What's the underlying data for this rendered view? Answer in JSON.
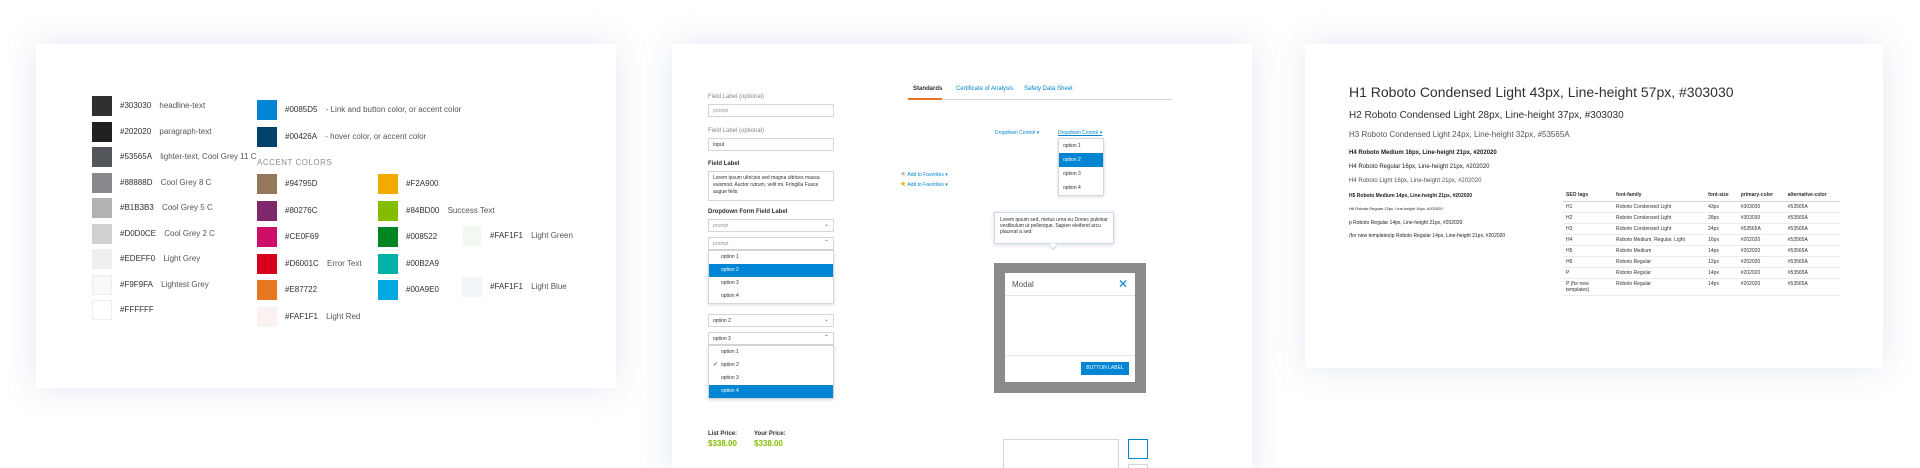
{
  "colors_card": {
    "neutrals": [
      {
        "hex": "#303030",
        "label": "#303030",
        "desc": "headline-text"
      },
      {
        "hex": "#202020",
        "label": "#202020",
        "desc": "paragraph-text"
      },
      {
        "hex": "#53565A",
        "label": "#53565A",
        "desc": "lighter-text, Cool Grey 11 C"
      },
      {
        "hex": "#88888D",
        "label": "#88888D",
        "desc": "Cool Grey 8 C"
      },
      {
        "hex": "#B1B3B3",
        "label": "#B1B3B3",
        "desc": "Cool Grey 5 C"
      },
      {
        "hex": "#D0D0CE",
        "label": "#D0D0CE",
        "desc": "Cool Grey 2 C"
      },
      {
        "hex": "#EDEFF0",
        "label": "#EDEFF0",
        "desc": "Light Grey"
      },
      {
        "hex": "#F9F9FA",
        "label": "#F9F9FA",
        "desc": "Lightest Grey"
      },
      {
        "hex": "#FFFFFF",
        "label": "#FFFFFF",
        "desc": ""
      }
    ],
    "brand": [
      {
        "hex": "#0085D5",
        "label": "#0085D5",
        "desc": "- Link and button color, or accent color"
      },
      {
        "hex": "#00426A",
        "label": "#00426A",
        "desc": "- hover color, or accent color"
      }
    ],
    "accent_heading": "ACCENT COLORS",
    "accent_col1": [
      {
        "hex": "#94795D",
        "label": "#94795D",
        "desc": ""
      },
      {
        "hex": "#80276C",
        "label": "#80276C",
        "desc": ""
      },
      {
        "hex": "#CE0F69",
        "label": "#CE0F69",
        "desc": ""
      },
      {
        "hex": "#D6001C",
        "label": "#D6001C",
        "desc": "Error Text"
      },
      {
        "hex": "#E87722",
        "label": "#E87722",
        "desc": ""
      },
      {
        "hex": "#FAF1F1",
        "label": "#FAF1F1",
        "desc": "Light Red"
      }
    ],
    "accent_col2": [
      {
        "hex": "#F2A900",
        "label": "#F2A900",
        "desc": ""
      },
      {
        "hex": "#84BD00",
        "label": "#84BD00",
        "desc": "Success Text"
      },
      {
        "hex": "#008522",
        "label": "#008522",
        "desc": ""
      },
      {
        "hex": "#00B2A9",
        "label": "#00B2A9",
        "desc": ""
      },
      {
        "hex": "#00A9E0",
        "label": "#00A9E0",
        "desc": ""
      }
    ],
    "accent_col3": [
      {
        "hex": "#F1F9F2",
        "label": "#FAF1F1",
        "desc": "Light Green"
      },
      {
        "hex": "#F1F6FB",
        "label": "#FAF1F1",
        "desc": "Light Blue"
      }
    ]
  },
  "forms_card": {
    "field1": {
      "label": "Field Label",
      "hint": "(optional)",
      "placeholder": "prompt"
    },
    "field2": {
      "label": "Field Label",
      "hint": "(optional)",
      "value": "Input"
    },
    "field3": {
      "label": "Field Label",
      "value": "Lorem ipsum ultricies sed magna ultrices massa euismod. Auctor rutrum, velit mi. Fringilla Fusce augue felis."
    },
    "dropdown_label": "Dropdown Form Field Label",
    "dd1": {
      "placeholder": "prompt"
    },
    "dd2": {
      "placeholder": "prompt",
      "options": [
        "option 1",
        "option 2",
        "option 3",
        "option 4"
      ],
      "selected_index": 1
    },
    "dd3": {
      "value": "option 2"
    },
    "dd4": {
      "value": "option 3",
      "options": [
        "option 1",
        "option 2",
        "option 3",
        "option 4"
      ],
      "checked_index": 1,
      "highlight_index": 3
    },
    "tabs": [
      {
        "label": "Standards",
        "active": true
      },
      {
        "label": "Certificate of Analysis",
        "active": false
      },
      {
        "label": "Safety Data Sheet",
        "active": false
      }
    ],
    "favorites": [
      "Add to Favorites",
      "Add to Favorites"
    ],
    "dropdown_control_1": "Dropdown Control",
    "dropdown_control_2": "Dropdown Control",
    "control_options": [
      "option 1",
      "option 2",
      "option 3",
      "option 4"
    ],
    "control_selected_index": 1,
    "tooltip_text": "Lorem ipsum sed, metus urna eu Donec pulvinar vestibulum ut pellenque. Sapien eleifend arcu placerat a sed",
    "modal": {
      "title": "Modal",
      "button": "BUTTON LABEL"
    },
    "list_price_label": "List Price:",
    "list_price_value": "$338.00",
    "your_price_label": "Your Price:",
    "your_price_value": "$338.00"
  },
  "type_card": {
    "h1": "H1 Roboto Condensed Light 43px, Line-height 57px, #303030",
    "h2": "H2 Roboto Condensed Light 28px, Line-height 37px,  #303030",
    "h3": "H3 Roboto Condensed Light 24px, Line-height 32px,  #53565A",
    "h4a": "H4 Roboto Medium 16px, Line-height 21px, #202020",
    "h4b": "H4 Roboto Regular 16px, Line-height 21px, #202020",
    "h4c": "H4 Roboto Light 16px, Line-height 21px, #202020",
    "h5a": "H5 Roboto Medium 14px, Line-height 21px, #202020",
    "h6": "H6 Roboto Regular 12px, Line-height 16px, #202020",
    "p": "p Roboto Regular 14px, Line-height 21px, #202020",
    "pnew": "(for new templates)p Roboto Regular 14px, Line-height 21px, #202020",
    "table_headers": [
      "SEO tags",
      "font-family",
      "font-size",
      "primary-color",
      "alternative-color"
    ],
    "table_rows": [
      [
        "H1",
        "Roboto Condensed Light",
        "43px",
        "#303030",
        "#53565A"
      ],
      [
        "H2",
        "Roboto Condensed Light",
        "28px",
        "#303030",
        "#53565A"
      ],
      [
        "H3",
        "Roboto Condensed Light",
        "24px",
        "#53565A",
        "#53565A"
      ],
      [
        "H4",
        "Roboto Medium, Regular, Light",
        "16px",
        "#202020",
        "#53565A"
      ],
      [
        "H5",
        "Roboto Medium",
        "14px",
        "#202020",
        "#53565A"
      ],
      [
        "H6",
        "Roboto Regular",
        "12px",
        "#202020",
        "#53565A"
      ],
      [
        "P",
        "Roboto Regular",
        "14px",
        "#202020",
        "#53565A"
      ],
      [
        "P (for new templates)",
        "Roboto Regular",
        "14px",
        "#202020",
        "#53565A"
      ]
    ]
  }
}
